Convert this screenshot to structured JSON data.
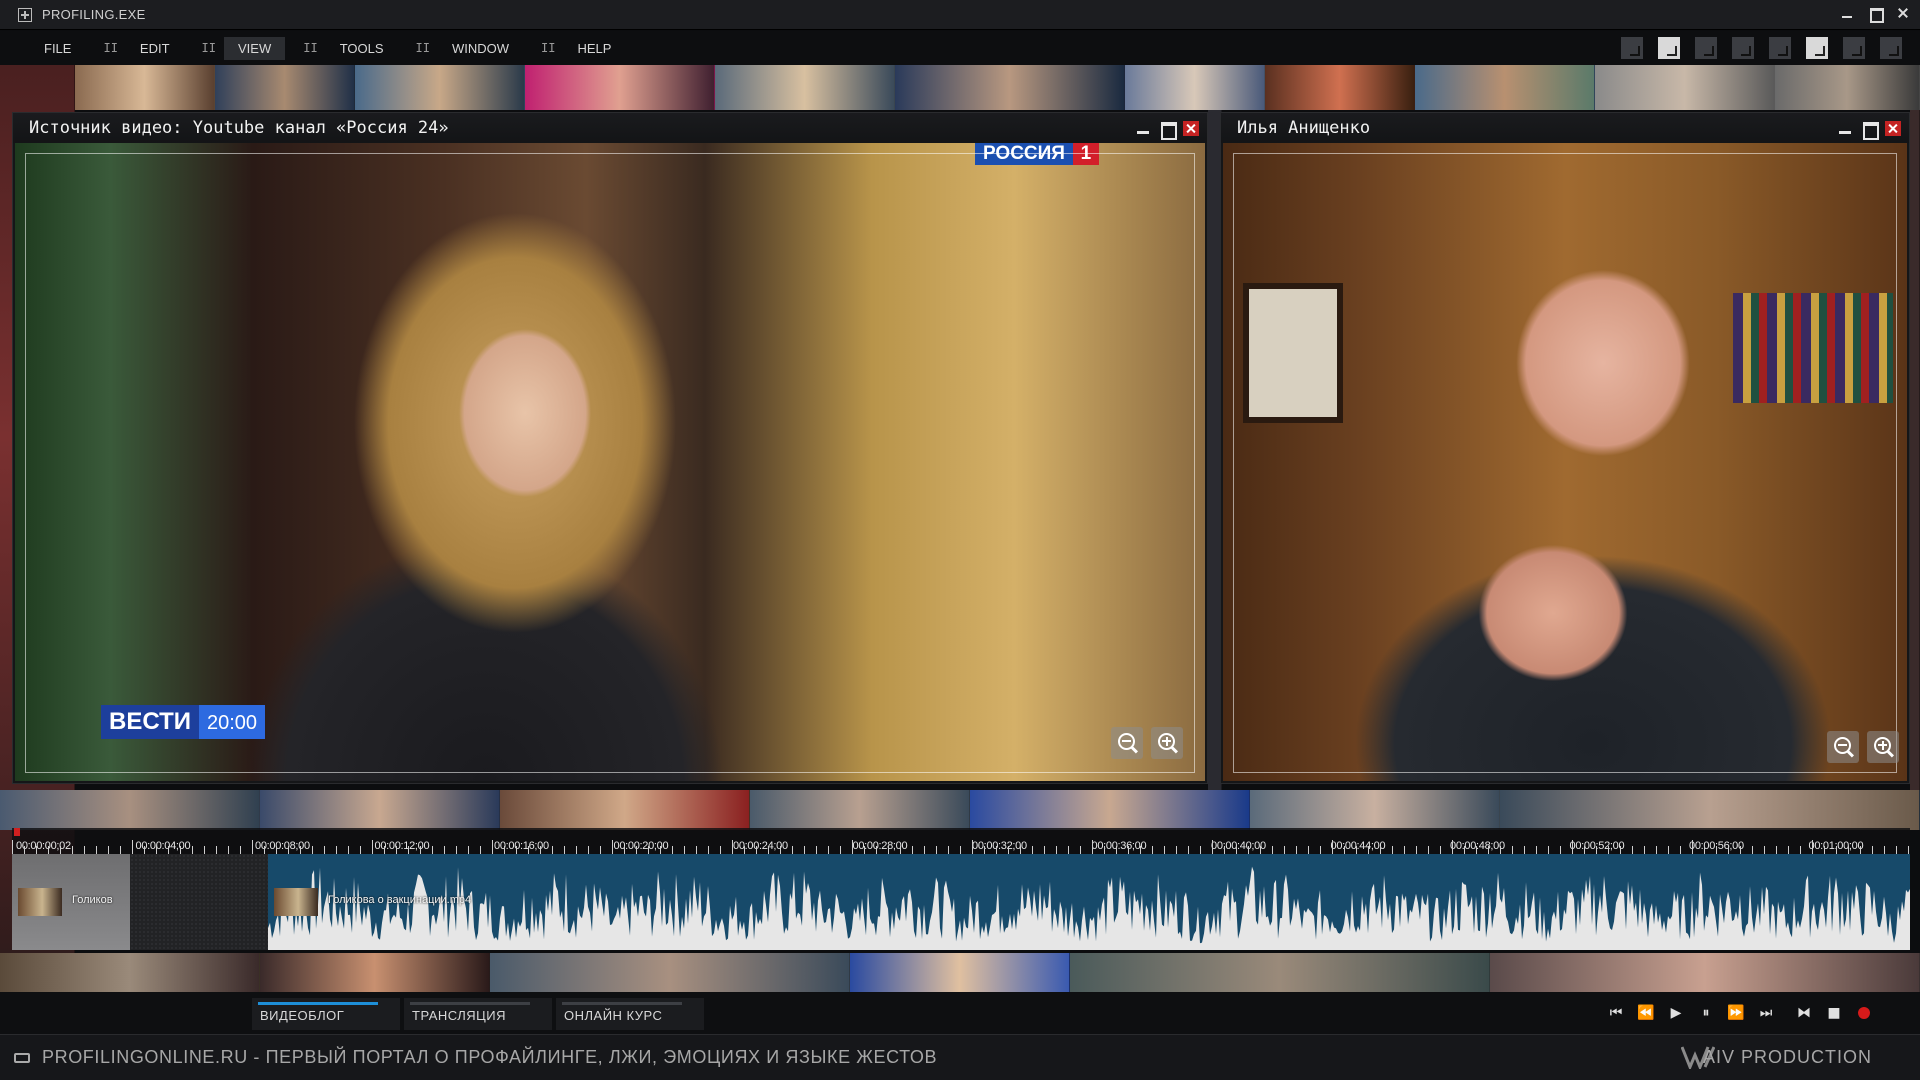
{
  "app": {
    "title": "PROFILING.EXE"
  },
  "menu": {
    "items": [
      {
        "label": "FILE"
      },
      {
        "label": "EDIT"
      },
      {
        "label": "VIEW"
      },
      {
        "label": "TOOLS"
      },
      {
        "label": "WINDOW"
      },
      {
        "label": "HELP"
      }
    ],
    "separator": "II",
    "active": "VIEW"
  },
  "windows": {
    "left": {
      "title": "Источник видео: Youtube канал «Россия 24»",
      "channel_logo": {
        "name": "РОССИЯ",
        "number": "1"
      },
      "show_logo": {
        "name": "ВЕСТИ",
        "time": "20:00"
      }
    },
    "right": {
      "title": "Илья Анищенко"
    }
  },
  "timeline": {
    "ticks": [
      "00:00:00;02",
      "00:00:04;00",
      "00:00:08;00",
      "00:00:12;00",
      "00:00:16;00",
      "00:00:20;00",
      "00:00:24;00",
      "00:00:28;00",
      "00:00:32;00",
      "00:00:36;00",
      "00:00:40;00",
      "00:00:44;00",
      "00:00:48;00",
      "00:00:52;00",
      "00:00:56;00",
      "00:01:00;00"
    ],
    "clips": [
      {
        "label": "Голиков"
      },
      {
        "label": "Голикова о вакцинации.mp4"
      }
    ]
  },
  "tabs": [
    {
      "label": "ВИДЕОБЛОГ",
      "active": true
    },
    {
      "label": "ТРАНСЛЯЦИЯ",
      "active": false
    },
    {
      "label": "ОНЛАЙН КУРС",
      "active": false
    }
  ],
  "footer": {
    "text": "PROFILINGONLINE.RU - ПЕРВЫЙ ПОРТАЛ О ПРОФАЙЛИНГЕ, ЛЖИ, ЭМОЦИЯХ И ЯЗЫКЕ ЖЕСТОВ",
    "brand": "AIV PRODUCTION"
  },
  "colors": {
    "accent": "#1e8fd8",
    "close": "#c42323",
    "record": "#d61a1a",
    "waveform_bg": "#174a6a",
    "waveform": "#e6e6e6"
  }
}
